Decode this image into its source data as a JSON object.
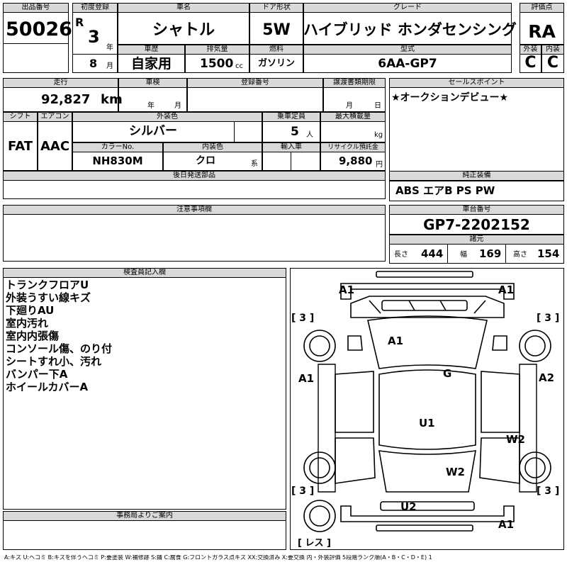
{
  "header": {
    "lot_label": "出品番号",
    "lot_no": "50026",
    "first_reg_label": "初度登録",
    "era_letter": "R",
    "year": "3",
    "year_unit": "年",
    "month": "8",
    "month_unit": "月",
    "car_name_label": "車名",
    "car_name": "シャトル",
    "door_label": "ドア形状",
    "door": "5W",
    "grade_label": "グレード",
    "grade": "ハイブリッド ホンダセンシング",
    "score_label": "評価点",
    "score": "RA",
    "history_label": "車歴",
    "history": "自家用",
    "displacement_label": "排気量",
    "displacement": "1500",
    "displacement_unit": "cc",
    "fuel_label": "燃料",
    "fuel": "ガソリン",
    "model_label": "型式",
    "model": "6AA-GP7",
    "exterior_label": "外装",
    "exterior": "C",
    "interior_label": "内装",
    "interior": "C"
  },
  "row2": {
    "mileage_label": "走行",
    "mileage": "92,827",
    "mileage_unit": "km",
    "inspection_label": "車検",
    "inspection_year_unit": "年",
    "inspection_month_unit": "月",
    "reg_no_label": "登録番号",
    "transfer_label": "譲渡書類期限",
    "transfer_month_unit": "月",
    "transfer_day_unit": "日",
    "sales_point_label": "セールスポイント",
    "sales_point": "★オークションデビュー★",
    "shift_label": "シフト",
    "shift": "FAT",
    "ac_label": "エアコン",
    "ac": "AAC",
    "ext_color_label": "外装色",
    "ext_color": "シルバー",
    "capacity_label": "乗車定員",
    "capacity": "5",
    "capacity_unit": "人",
    "max_load_label": "最大積載量",
    "max_load_unit": "kg",
    "color_no_label": "カラーNo.",
    "color_no": "NH830M",
    "int_color_label": "内装色",
    "int_color": "クロ",
    "int_color_unit": "系",
    "import_label": "輸入車",
    "recycle_label": "リサイクル預託金",
    "recycle": "9,880",
    "recycle_unit": "円",
    "later_parts_label": "後日発送部品",
    "equipment_label": "純正装備",
    "equipment": "ABS エアB PS PW",
    "notes_label": "注意事項欄",
    "chassis_label": "車台番号",
    "chassis": "GP7-2202152",
    "dims_label": "諸元",
    "length_label": "長さ",
    "length": "444",
    "width_label": "幅",
    "width": "169",
    "height_label": "高さ",
    "height": "154"
  },
  "inspector": {
    "label": "検査員記入欄",
    "lines": [
      "トランクフロアU",
      "外装うすい線キズ",
      "下廻りAU",
      "室内汚れ",
      "室内内張傷",
      "コンソール傷、のり付",
      "シートすれ小、汚れ",
      "バンパー下A",
      "ホイールカバーA"
    ]
  },
  "office_label": "事務局よりご案内",
  "diagram": {
    "marks": [
      "A1",
      "A1",
      "A1",
      "G",
      "A1",
      "A2",
      "U1",
      "W2",
      "W2",
      "U2",
      "A1"
    ],
    "tires": [
      "[ 3 ]",
      "[ 3 ]",
      "[ 3 ]",
      "[ 3 ]"
    ],
    "spare": "[ レス ]"
  },
  "legend": "A:キズ U:ヘコミ B:キズを伴うヘコミ P:要塗装 W:補修跡 S:錆 C:腐食 G:フロントガラス点キズ XX:交換済み X:要交換 内・外装評価 5段階ランク順(A・B・C・D・E) 1"
}
